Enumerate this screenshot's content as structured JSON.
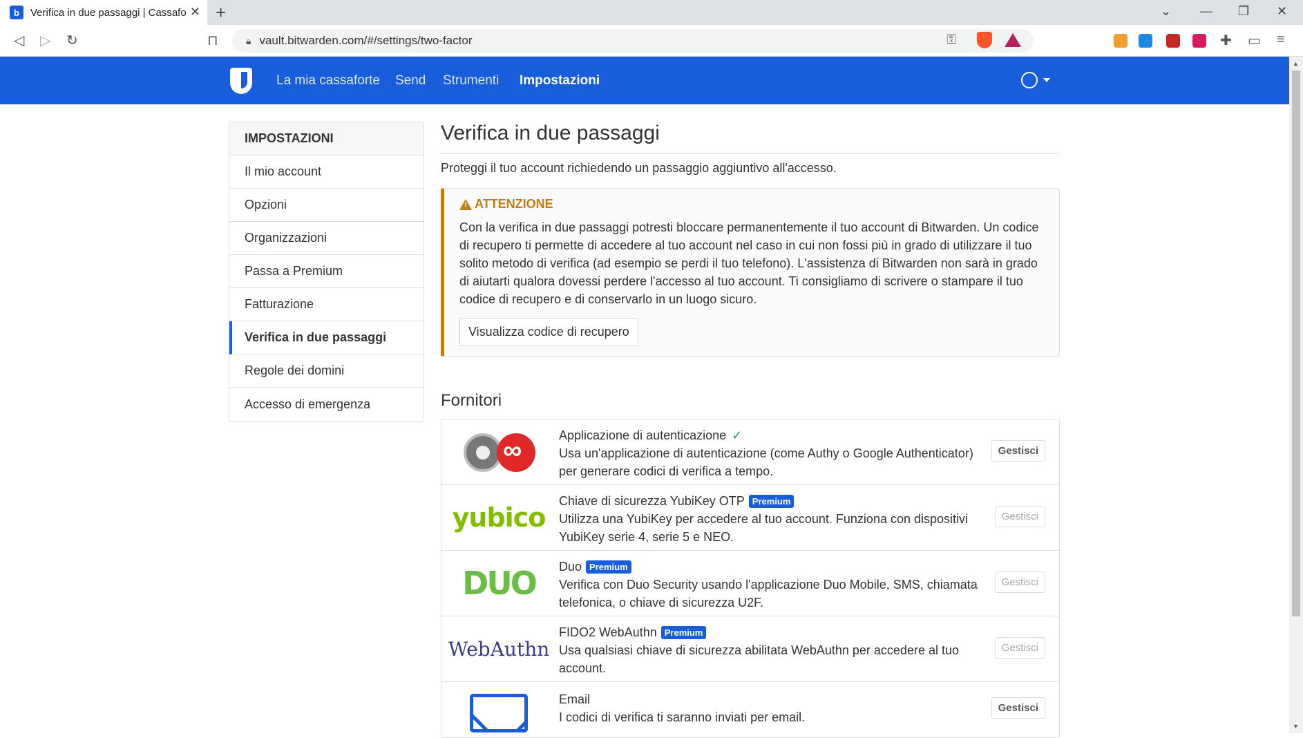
{
  "browser": {
    "tab_title": "Verifica in due passaggi | Cassafor",
    "url": "vault.bitwarden.com/#/settings/two-factor"
  },
  "nav": {
    "links": [
      "La mia cassaforte",
      "Send",
      "Strumenti",
      "Impostazioni"
    ],
    "active": "Impostazioni"
  },
  "sidebar": {
    "heading": "IMPOSTAZIONI",
    "items": [
      {
        "label": "Il mio account"
      },
      {
        "label": "Opzioni"
      },
      {
        "label": "Organizzazioni"
      },
      {
        "label": "Passa a Premium"
      },
      {
        "label": "Fatturazione"
      },
      {
        "label": "Verifica in due passaggi"
      },
      {
        "label": "Regole dei domini"
      },
      {
        "label": "Accesso di emergenza"
      }
    ],
    "active_item": "Verifica in due passaggi"
  },
  "main": {
    "title": "Verifica in due passaggi",
    "lead": "Proteggi il tuo account richiedendo un passaggio aggiuntivo all'accesso.",
    "warning": {
      "title": "ATTENZIONE",
      "body": "Con la verifica in due passaggi potresti bloccare permanentemente il tuo account di Bitwarden. Un codice di recupero ti permette di accedere al tuo account nel caso in cui non fossi più in grado di utilizzare il tuo solito metodo di verifica (ad esempio se perdi il tuo telefono). L'assistenza di Bitwarden non sarà in grado di aiutarti qualora dovessi perdere l'accesso al tuo account. Ti consigliamo di scrivere o stampare il tuo codice di recupero e di conservarlo in un luogo sicuro.",
      "button": "Visualizza codice di recupero"
    },
    "providers_title": "Fornitori",
    "premium_label": "Premium",
    "manage_label": "Gestisci",
    "providers": [
      {
        "name": "Applicazione di autenticazione",
        "description": "Usa un'applicazione di autenticazione (come Authy o Google Authenticator) per generare codici di verifica a tempo.",
        "premium": false,
        "enabled": true
      },
      {
        "name": "Chiave di sicurezza YubiKey OTP",
        "description": "Utilizza una YubiKey per accedere al tuo account. Funziona con dispositivi YubiKey serie 4, serie 5 e NEO.",
        "premium": true,
        "enabled": false,
        "logo_text": "yubico"
      },
      {
        "name": "Duo",
        "description": "Verifica con Duo Security usando l'applicazione Duo Mobile, SMS, chiamata telefonica, o chiave di sicurezza U2F.",
        "premium": true,
        "enabled": false,
        "logo_text": "DUO"
      },
      {
        "name": "FIDO2 WebAuthn",
        "description": "Usa qualsiasi chiave di sicurezza abilitata WebAuthn per accedere al tuo account.",
        "premium": true,
        "enabled": false,
        "logo_text": "WebAuthn"
      },
      {
        "name": "Email",
        "description": "I codici di verifica ti saranno inviati per email.",
        "premium": false,
        "enabled": false
      }
    ]
  },
  "colors": {
    "brand": "#175ddc",
    "warning": "#bf7e16"
  }
}
